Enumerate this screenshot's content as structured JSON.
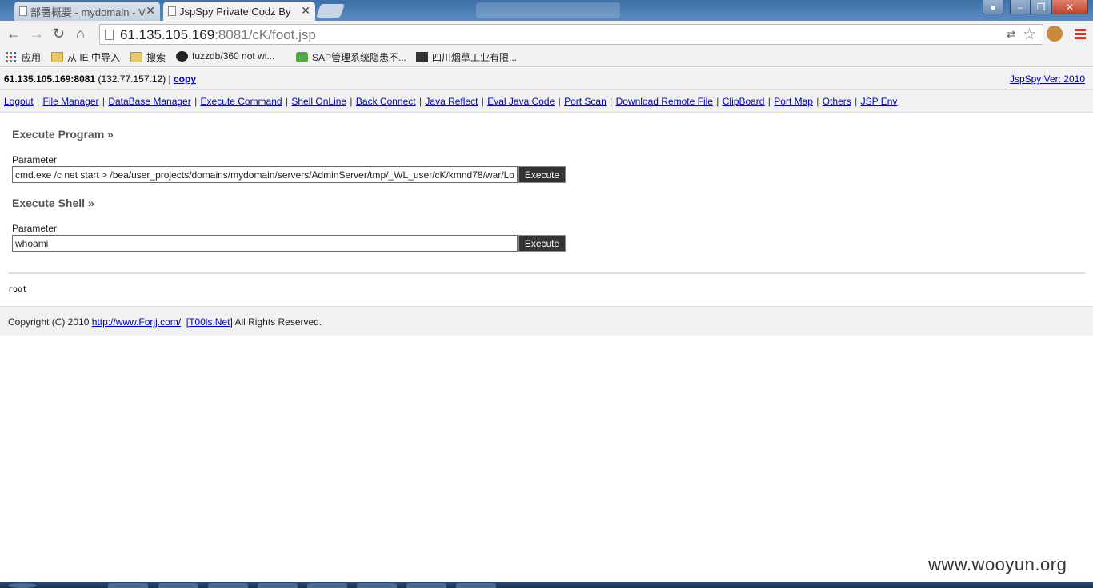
{
  "browser": {
    "tabs": [
      {
        "title": "部署概要 - mydomain - V"
      },
      {
        "title": "JspSpy Private Codz By"
      }
    ],
    "url_host": "61.135.105.169",
    "url_rest": ":8081/cK/foot.jsp",
    "bookmarks": [
      {
        "label": "应用"
      },
      {
        "label": "从 IE 中导入"
      },
      {
        "label": "搜索"
      },
      {
        "label": "fuzzdb/360 not wi..."
      },
      {
        "label": "SAP管理系统隐患不..."
      },
      {
        "label": "四川烟草工业有限..."
      }
    ]
  },
  "header": {
    "host": "61.135.105.169:8081",
    "client_ip": "(132.77.157.12)",
    "separator": "|",
    "copy_label": "copy",
    "version": "JspSpy Ver: 2010"
  },
  "nav": [
    "Logout",
    "File Manager",
    "DataBase Manager",
    "Execute Command",
    "Shell OnLine",
    "Back Connect",
    "Java Reflect",
    "Eval Java Code",
    "Port Scan",
    "Download Remote File",
    "ClipBoard",
    "Port Map",
    "Others",
    "JSP Env"
  ],
  "execute_program": {
    "title": "Execute Program »",
    "param_label": "Parameter",
    "value": "cmd.exe /c net start > /bea/user_projects/domains/mydomain/servers/AdminServer/tmp/_WL_user/cK/kmnd78/war/Lo",
    "button": "Execute"
  },
  "execute_shell": {
    "title": "Execute Shell »",
    "param_label": "Parameter",
    "value": "whoami",
    "button": "Execute"
  },
  "output": "root",
  "footer": {
    "prefix": "Copyright (C) 2010",
    "link1": "http://www.Forjj.com/",
    "link2": "[T00ls.Net]",
    "suffix": "All Rights Reserved."
  },
  "watermark": "www.wooyun.org"
}
